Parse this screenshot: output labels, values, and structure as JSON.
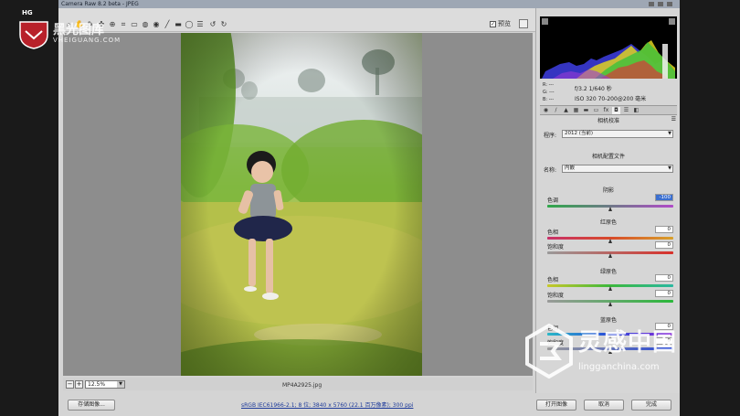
{
  "window": {
    "title": "Camera Raw 8.2 beta - JPEG"
  },
  "toolbar": {
    "preview_label": "预览",
    "preview_checked": true
  },
  "image": {
    "filename": "MP4A2925.jpg"
  },
  "statusbar": {
    "zoom": "12.5%"
  },
  "bottombar": {
    "save_label": "存储图像...",
    "workflow_text": "sRGB IEC61966-2.1; 8 位; 3840 x 5760 (22.1 百万像素); 300 ppi",
    "open_label": "打开图像",
    "cancel_label": "取消",
    "done_label": "完成"
  },
  "camera_info": {
    "r_label": "R:",
    "g_label": "G:",
    "b_label": "B:",
    "r_value": "---",
    "g_value": "---",
    "b_value": "---",
    "aperture_shutter": "f/3.2  1/640 秒",
    "iso_lens": "ISO 320  70-200@200 毫米"
  },
  "panel": {
    "title": "相机校准",
    "process_label": "程序:",
    "process_value": "2012 (当前)",
    "profile_head": "相机配置文件",
    "name_label": "名称:",
    "name_value": "内嵌",
    "shadows_head": "阴影",
    "tint_label": "色调",
    "tint_value": "-100",
    "red_head": "红原色",
    "green_head": "绿原色",
    "blue_head": "蓝原色",
    "hue_label": "色相",
    "sat_label": "饱和度",
    "red_hue": "0",
    "red_sat": "0",
    "green_hue": "0",
    "green_sat": "0",
    "blue_hue": "0",
    "blue_sat": "0"
  },
  "watermarks": {
    "hg_logo": "HG",
    "hg_name": "黑光图库",
    "hg_url": "VHEIGUANG.COM",
    "lg_name": "灵感中国",
    "lg_url": "lingganchina.com"
  },
  "colors": {
    "accent_blue": "#3b6fd0",
    "canvas_gray": "#8d8d8d",
    "panel_gray": "#d6d6d6"
  }
}
